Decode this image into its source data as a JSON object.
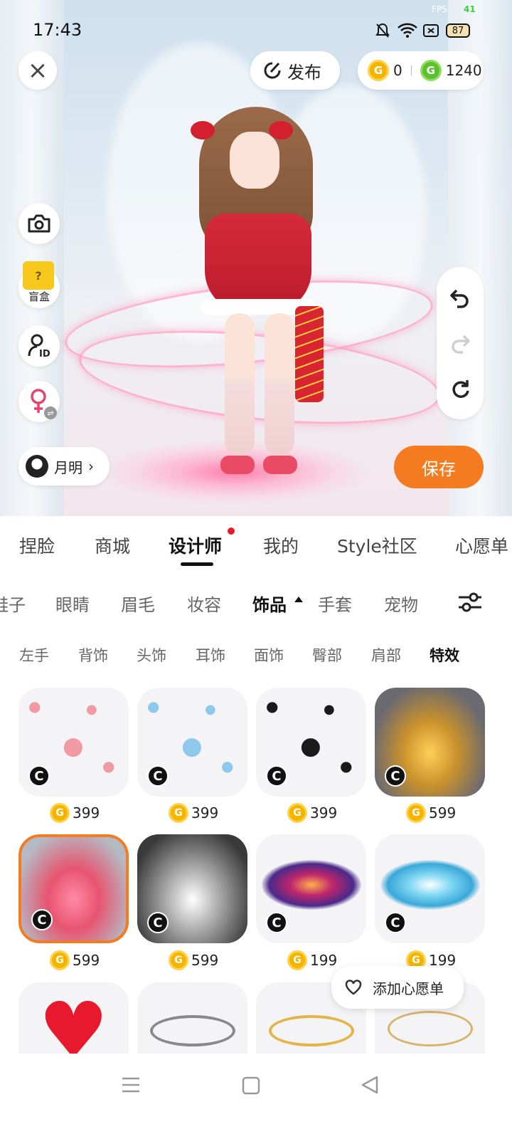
{
  "status": {
    "time": "17:43",
    "fps_label": "FPS",
    "fps_value": "41",
    "battery": "87"
  },
  "top": {
    "close_label": "×",
    "publish_label": "发布",
    "gold_coins": "0",
    "green_coins": "1240",
    "coin_glyph": "G"
  },
  "left_tools": {
    "blindbox_label": "盲盒",
    "user_name": "月明"
  },
  "save_label": "保存",
  "main_tabs": [
    {
      "label": "捏脸"
    },
    {
      "label": "商城"
    },
    {
      "label": "设计师"
    },
    {
      "label": "我的"
    },
    {
      "label": "Style社区"
    },
    {
      "label": "心愿单"
    }
  ],
  "sub_tabs": [
    {
      "label": "鞋子"
    },
    {
      "label": "眼睛"
    },
    {
      "label": "眉毛"
    },
    {
      "label": "妆容"
    },
    {
      "label": "饰品"
    },
    {
      "label": "手套"
    },
    {
      "label": "宠物"
    }
  ],
  "categories": [
    {
      "label": "左手"
    },
    {
      "label": "背饰"
    },
    {
      "label": "头饰"
    },
    {
      "label": "耳饰"
    },
    {
      "label": "面饰"
    },
    {
      "label": "臀部"
    },
    {
      "label": "肩部"
    },
    {
      "label": "特效"
    }
  ],
  "items": [
    {
      "price": "399"
    },
    {
      "price": "399"
    },
    {
      "price": "399"
    },
    {
      "price": "599"
    },
    {
      "price": "599"
    },
    {
      "price": "599"
    },
    {
      "price": "199"
    },
    {
      "price": "199"
    }
  ],
  "badge_glyph": "C",
  "wishlist_label": "添加心愿单",
  "colors": {
    "accent": "#f47b20",
    "gold": "#f5b400",
    "green": "#5dc02f",
    "tab_dot": "#e8192c"
  }
}
